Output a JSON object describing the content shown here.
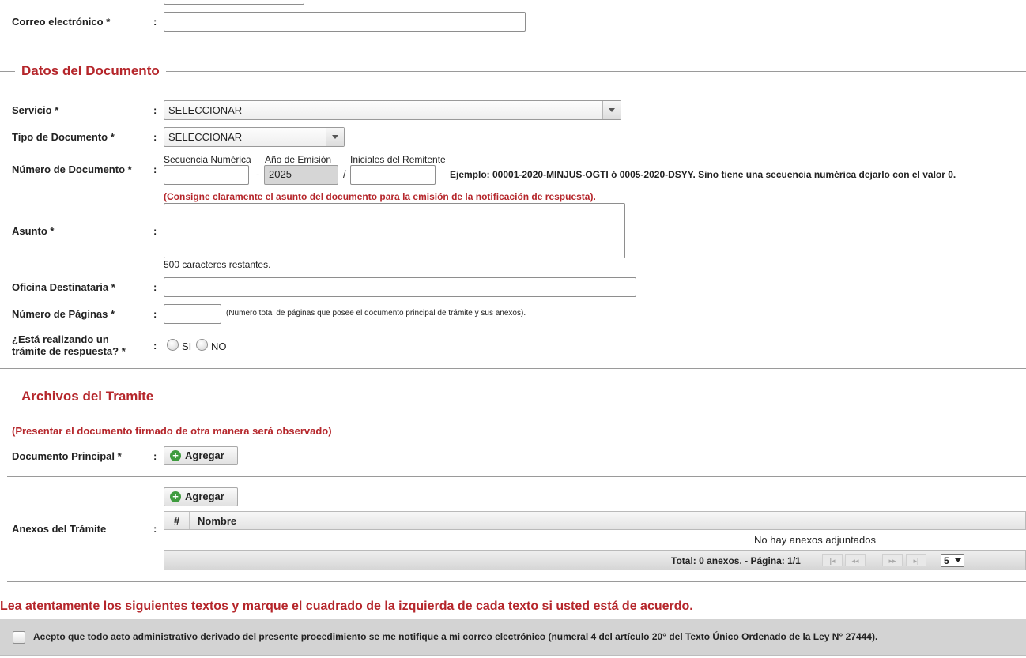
{
  "contact": {
    "email_label": "Correo electrónico *",
    "colon": ":",
    "email_value": ""
  },
  "document_section": {
    "title": "Datos del Documento",
    "servicio_label": "Servicio *",
    "servicio_value": "SELECCIONAR",
    "tipo_label": "Tipo de Documento *",
    "tipo_value": "SELECCIONAR",
    "numero_label": "Número de Documento *",
    "secuencia_label": "Secuencia Numérica",
    "anio_label": "Año de Emisión",
    "iniciales_label": "Iniciales del Remitente",
    "secuencia_value": "",
    "dash": "-",
    "anio_value": "2025",
    "slash": "/",
    "iniciales_value": "",
    "ejemplo": "Ejemplo: 00001-2020-MINJUS-OGTI ó 0005-2020-DSYY. Sino tiene una secuencia numérica dejarlo con el valor 0.",
    "asunto_note": "(Consigne claramente el asunto del documento para la emisión de la notificación de respuesta).",
    "asunto_label": "Asunto *",
    "asunto_value": "",
    "caracteres": "500 caracteres restantes.",
    "oficina_label": "Oficina Destinataria *",
    "oficina_value": "",
    "paginas_label": "Número de Páginas *",
    "paginas_value": "",
    "paginas_note": "(Numero total de páginas que posee el documento principal de trámite y sus anexos).",
    "respuesta_label_1": "¿Está realizando un",
    "respuesta_label_2": "trámite de respuesta? *",
    "radio_si": "SI",
    "radio_no": "NO"
  },
  "files_section": {
    "title": "Archivos del Tramite",
    "note": "(Presentar el documento firmado de otra manera será observado)",
    "principal_label": "Documento Principal *",
    "agregar_label": "Agregar",
    "anexos_label": "Anexos del Trámite",
    "grid_columns": [
      "#",
      "Nombre"
    ],
    "empty_message": "No hay anexos adjuntados",
    "pager_total": "Total: 0 anexos. - Página: 1/1",
    "page_size": "5"
  },
  "terms": {
    "heading": "Lea atentamente los siguientes textos y marque el cuadrado de la izquierda de cada texto si usted está de acuerdo.",
    "accept_text": "Acepto que todo acto administrativo derivado del presente procedimiento se me notifique a mi correo electrónico (numeral 4 del artículo 20° del Texto Único Ordenado de la Ley N° 27444)."
  },
  "colors": {
    "accent_red": "#b5262b",
    "success_green": "#3e9b3e"
  },
  "icons": [
    "plus-circle-icon",
    "chevron-down-icon",
    "first-page-icon",
    "prev-page-icon",
    "next-page-icon",
    "last-page-icon"
  ]
}
